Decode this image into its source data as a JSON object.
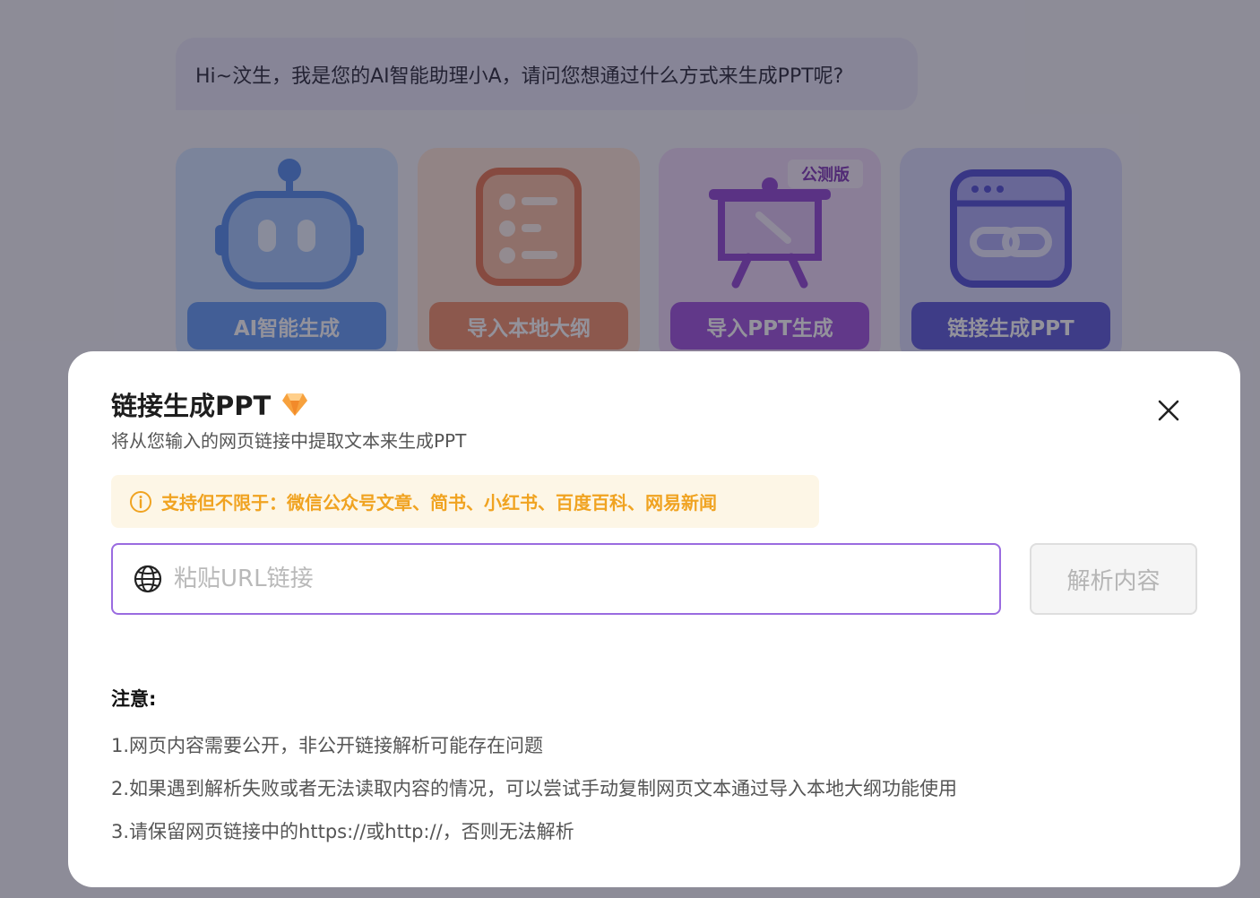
{
  "chat": {
    "greeting": "Hi~汶生，我是您的AI智能助理小A，请问您想通过什么方式来生成PPT呢?"
  },
  "options": [
    {
      "label": "AI智能生成",
      "icon": "robot-icon"
    },
    {
      "label": "导入本地大纲",
      "icon": "outline-list-icon"
    },
    {
      "label": "导入PPT生成",
      "icon": "presentation-easel-icon",
      "badge": "公测版"
    },
    {
      "label": "链接生成PPT",
      "icon": "link-window-icon"
    }
  ],
  "modal": {
    "title": "链接生成PPT",
    "title_icon": "diamond-gem-icon",
    "subtitle": "将从您输入的网页链接中提取文本来生成PPT",
    "tip": "支持但不限于：微信公众号文章、简书、小红书、百度百科、网易新闻",
    "url_placeholder": "粘贴URL链接",
    "url_value": "",
    "parse_label": "解析内容",
    "notes_title": "注意:",
    "notes": [
      "1.网页内容需要公开，非公开链接解析可能存在问题",
      "2.如果遇到解析失败或者无法读取内容的情况，可以尝试手动复制网页文本通过导入本地大纲功能使用",
      "3.请保留网页链接中的https://或http://，否则无法解析"
    ]
  },
  "colors": {
    "accent": "#9a6be0",
    "tip_text": "#f0a321",
    "tip_bg": "#fdf6e6",
    "ai_card": "#5c97f4",
    "outline_card": "#f18a63",
    "pptimp_card": "#9a4bdb",
    "link_card": "#5452d6"
  }
}
